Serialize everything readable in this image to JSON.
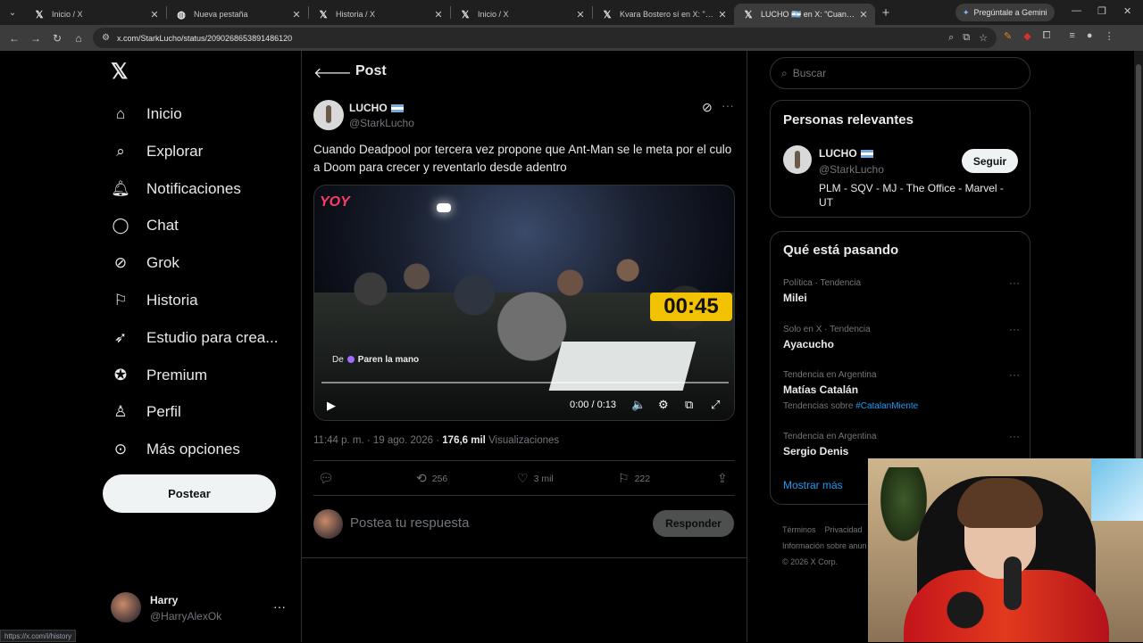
{
  "browser": {
    "tabs": [
      {
        "title": "Inicio / X",
        "icon": "x-logo-icon"
      },
      {
        "title": "Nueva pestaña",
        "icon": "globe-icon"
      },
      {
        "title": "Historia / X",
        "icon": "x-logo-icon"
      },
      {
        "title": "Inicio / X",
        "icon": "x-logo-icon"
      },
      {
        "title": "Kvara Bostero sí en X: \"Doom d",
        "icon": "x-logo-icon"
      },
      {
        "title": "LUCHO 🇦🇷 en X: \"Cuando Dead",
        "icon": "x-logo-icon",
        "active": true
      }
    ],
    "gemini_label": "Pregúntale a Gemini",
    "url": "x.com/StarkLucho/status/2090268653891486120",
    "status_url": "https://x.com/i/history"
  },
  "nav": {
    "items": [
      {
        "label": "Inicio",
        "icon": "home-icon"
      },
      {
        "label": "Explorar",
        "icon": "search-icon"
      },
      {
        "label": "Notificaciones",
        "icon": "bell-icon"
      },
      {
        "label": "Chat",
        "icon": "chat-icon"
      },
      {
        "label": "Grok",
        "icon": "grok-icon"
      },
      {
        "label": "Historia",
        "icon": "bookmark-icon"
      },
      {
        "label": "Estudio para crea...",
        "icon": "rocket-icon"
      },
      {
        "label": "Premium",
        "icon": "verified-icon"
      },
      {
        "label": "Perfil",
        "icon": "person-icon"
      },
      {
        "label": "Más opciones",
        "icon": "more-circle-icon"
      }
    ],
    "post_button": "Postear",
    "account": {
      "name": "Harry",
      "handle": "@HarryAlexOk"
    }
  },
  "post": {
    "header_title": "Post",
    "author": {
      "name": "LUCHO",
      "handle": "@StarkLucho"
    },
    "text": "Cuando Deadpool por tercera vez propone que Ant-Man se le meta por el culo a Doom para crecer y reventarlo desde adentro",
    "video": {
      "overlay_logo": "YOY",
      "timer": "00:45",
      "from_prefix": "De",
      "from_source": "Paren la mano",
      "time": "0:00 / 0:13"
    },
    "timestamp": "11:44 p. m. · 19 ago. 2026 · ",
    "views_count": "176,6 mil",
    "views_label": " Visualizaciones",
    "actions": {
      "retweets": "256",
      "likes": "3 mil",
      "bookmarks": "222"
    },
    "reply_placeholder": "Postea tu respuesta",
    "reply_button": "Responder"
  },
  "sidebar": {
    "search_placeholder": "Buscar",
    "relevant": {
      "title": "Personas relevantes",
      "name": "LUCHO",
      "handle": "@StarkLucho",
      "follow": "Seguir",
      "bio": "PLM - SQV - MJ - The Office - Marvel - UT"
    },
    "trending": {
      "title": "Qué está pasando",
      "items": [
        {
          "context": "Política · Tendencia",
          "name": "Milei"
        },
        {
          "context": "Solo en X · Tendencia",
          "name": "Ayacucho"
        },
        {
          "context": "Tendencia en Argentina",
          "name": "Matías Catalán",
          "sub_prefix": "Tendencias sobre ",
          "sub_tag": "#CatalanMiente"
        },
        {
          "context": "Tendencia en Argentina",
          "name": "Sergio Denis"
        }
      ],
      "show_more": "Mostrar más"
    },
    "footer": [
      "Términos",
      "Privacidad",
      "Información sobre anun",
      "© 2026 X Corp."
    ]
  }
}
